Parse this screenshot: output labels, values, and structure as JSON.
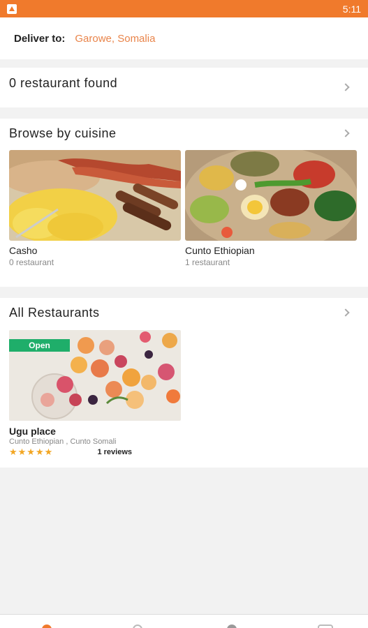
{
  "status_bar": {
    "time": "5:11"
  },
  "deliver": {
    "label": "Deliver to:",
    "location": "Garowe, Somalia"
  },
  "found": {
    "text": "0 restaurant found"
  },
  "cuisine": {
    "title": "Browse by cuisine",
    "items": [
      {
        "name": "Casho",
        "count": "0 restaurant"
      },
      {
        "name": "Cunto Ethiopian",
        "count": "1 restaurant"
      }
    ]
  },
  "restaurants": {
    "title": "All Restaurants",
    "items": [
      {
        "badge": "Open",
        "name": "Ugu place",
        "cuisines": "Cunto Ethiopian , Cunto Somali",
        "rating": 5,
        "stars": "★★★★★",
        "reviews": "1 reviews"
      }
    ]
  },
  "colors": {
    "accent": "#f07a2c",
    "open_badge": "#1fae6a",
    "star": "#f2a623"
  }
}
